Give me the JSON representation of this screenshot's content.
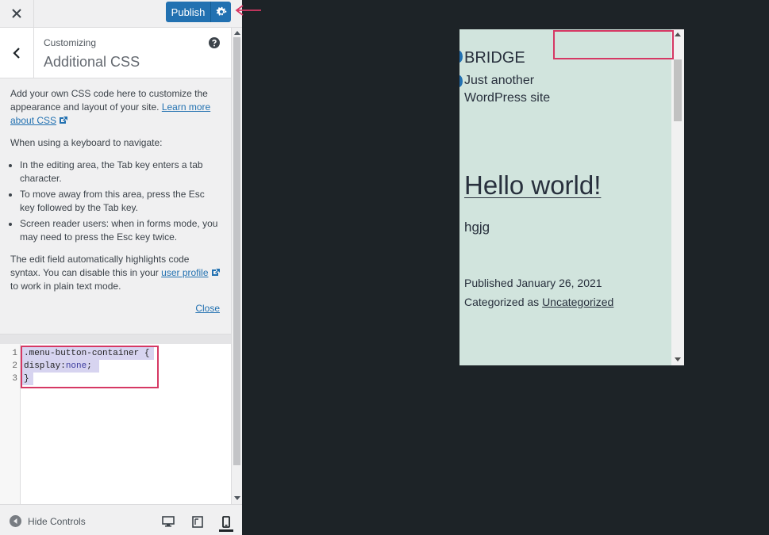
{
  "topbar": {
    "publish_label": "Publish"
  },
  "section": {
    "breadcrumb": "Customizing",
    "title": "Additional CSS"
  },
  "description": {
    "intro": "Add your own CSS code here to customize the appearance and layout of your site.",
    "learn_more_link": "Learn more about CSS",
    "keyboard_heading": "When using a keyboard to navigate:",
    "bullets": [
      "In the editing area, the Tab key enters a tab character.",
      "To move away from this area, press the Esc key followed by the Tab key.",
      "Screen reader users: when in forms mode, you may need to press the Esc key twice."
    ],
    "syntax_text_1": "The edit field automatically highlights code syntax. You can disable this in your",
    "user_profile_link": "user profile",
    "syntax_text_2": "to work in plain text mode.",
    "close_link": "Close"
  },
  "code_editor": {
    "line_numbers": [
      "1",
      "2",
      "3"
    ],
    "line1": ".menu-button-container {",
    "line2_prop": "display:",
    "line2_value": "none",
    "line2_end": ";",
    "line3": "}"
  },
  "footer": {
    "hide_controls_label": "Hide Controls"
  },
  "preview": {
    "site_title": "BRIDGE",
    "site_description": "Just another WordPress site",
    "post_title": "Hello world!",
    "post_body": "hgjg",
    "published_label": "Published January 26, 2021",
    "categorized_label": "Categorized as",
    "category_link": "Uncategorized"
  },
  "colors": {
    "accent": "#2271b1",
    "annotation": "#d63864",
    "preview_background": "#d1e4dd",
    "stage_background": "#1d2327"
  }
}
